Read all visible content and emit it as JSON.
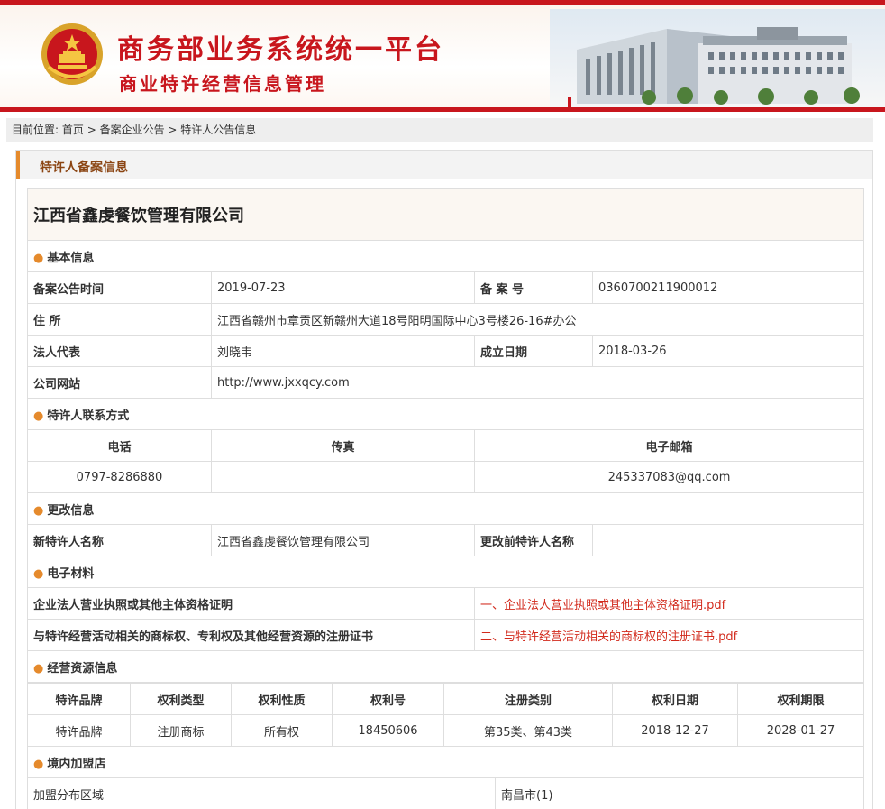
{
  "header": {
    "title_main": "商务部业务系统统一平台",
    "title_sub": "商业特许经营信息管理"
  },
  "breadcrumb": {
    "prefix": "目前位置:",
    "home": "首页",
    "sep": " > ",
    "level2": "备案企业公告",
    "level3": "特许人公告信息"
  },
  "panel": {
    "title": "特许人备案信息"
  },
  "company": {
    "name": "江西省鑫虔餐饮管理有限公司"
  },
  "basic": {
    "section_title": "基本信息",
    "announce_date_label": "备案公告时间",
    "announce_date": "2019-07-23",
    "record_no_label": "备 案 号",
    "record_no": "0360700211900012",
    "address_label": "住 所",
    "address": "江西省赣州市章贡区新赣州大道18号阳明国际中心3号楼26-16#办公",
    "legal_rep_label": "法人代表",
    "legal_rep": "刘晓韦",
    "founded_label": "成立日期",
    "founded": "2018-03-26",
    "website_label": "公司网站",
    "website": "http://www.jxxqcy.com"
  },
  "contact": {
    "section_title": "特许人联系方式",
    "phone_label": "电话",
    "fax_label": "传真",
    "email_label": "电子邮箱",
    "phone": "0797-8286880",
    "fax": "",
    "email": "245337083@qq.com"
  },
  "change": {
    "section_title": "更改信息",
    "new_name_label": "新特许人名称",
    "new_name": "江西省鑫虔餐饮管理有限公司",
    "old_name_label": "更改前特许人名称",
    "old_name": ""
  },
  "materials": {
    "section_title": "电子材料",
    "items": [
      {
        "label": "企业法人营业执照或其他主体资格证明",
        "file": "一、企业法人营业执照或其他主体资格证明.pdf"
      },
      {
        "label": "与特许经营活动相关的商标权、专利权及其他经营资源的注册证书",
        "file": "二、与特许经营活动相关的商标权的注册证书.pdf"
      }
    ]
  },
  "resources": {
    "section_title": "经营资源信息",
    "columns": [
      "特许品牌",
      "权利类型",
      "权利性质",
      "权利号",
      "注册类别",
      "权利日期",
      "权利期限"
    ],
    "rows": [
      [
        "特许品牌",
        "注册商标",
        "所有权",
        "18450606",
        "第35类、第43类",
        "2018-12-27",
        "2028-01-27"
      ]
    ]
  },
  "stores": {
    "section_title": "境内加盟店",
    "region_label": "加盟分布区域",
    "region_value": "南昌市(1)"
  },
  "colors": {
    "brand_red": "#c8161d",
    "accent_orange": "#e58a2c",
    "link_red": "#d22a1c"
  }
}
